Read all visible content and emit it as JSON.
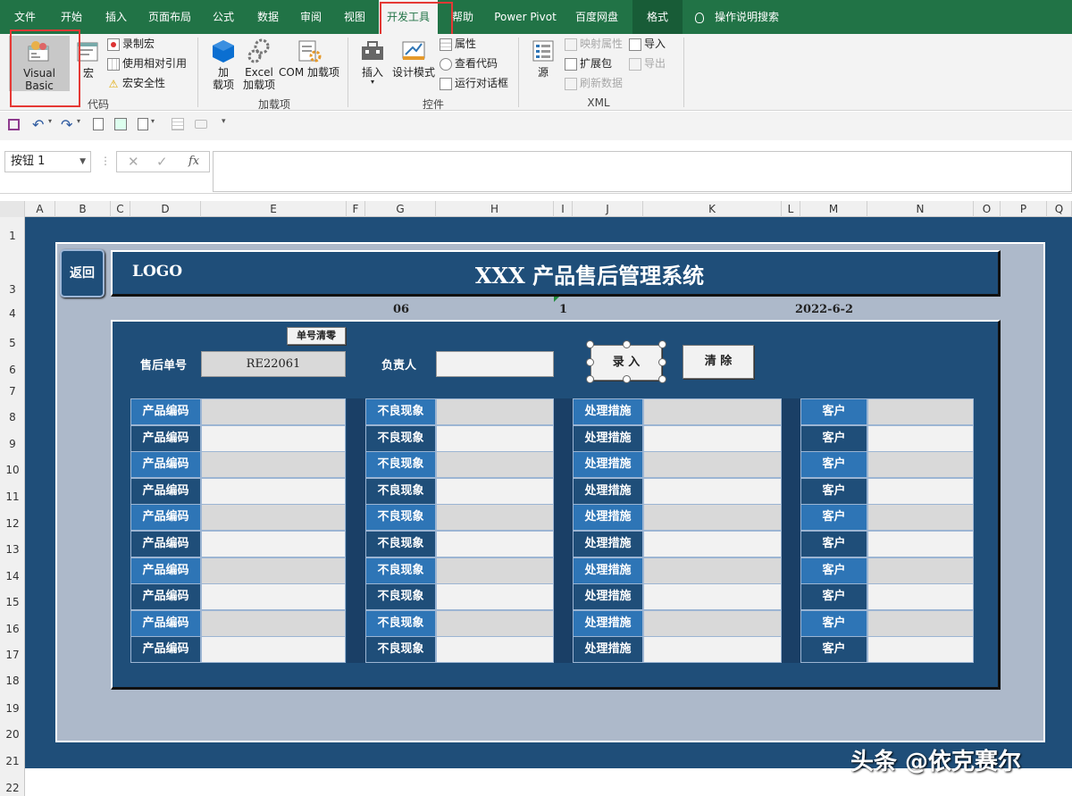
{
  "ribbon_tabs": [
    "文件",
    "开始",
    "插入",
    "页面布局",
    "公式",
    "数据",
    "审阅",
    "视图",
    "开发工具",
    "帮助",
    "Power Pivot",
    "百度网盘",
    "格式"
  ],
  "active_tab": "开发工具",
  "tell_me": "操作说明搜索",
  "groups": {
    "code": {
      "label": "代码",
      "visual_basic": "Visual Basic",
      "macros": "宏",
      "record_macro": "录制宏",
      "relative_ref": "使用相对引用",
      "macro_security": "宏安全性"
    },
    "addins": {
      "label": "加载项",
      "addins_l1": "加",
      "addins_l2": "载项",
      "excel_addins_l1": "Excel",
      "excel_addins_l2": "加载项",
      "com_addins": "COM 加载项"
    },
    "controls": {
      "label": "控件",
      "insert": "插入",
      "design_mode": "设计模式",
      "properties": "属性",
      "view_code": "查看代码",
      "run_dialog": "运行对话框"
    },
    "xml": {
      "label": "XML",
      "source": "源",
      "map_props": "映射属性",
      "expansion_packs": "扩展包",
      "refresh_data": "刷新数据",
      "import": "导入",
      "export": "导出"
    }
  },
  "namebox": "按钮 1",
  "fx_label": "fx",
  "columns": [
    "A",
    "B",
    "C",
    "D",
    "E",
    "F",
    "G",
    "H",
    "I",
    "J",
    "K",
    "L",
    "M",
    "N",
    "O",
    "P",
    "Q"
  ],
  "rows": [
    "1",
    "3",
    "4",
    "5",
    "6",
    "7",
    "8",
    "9",
    "10",
    "11",
    "12",
    "13",
    "14",
    "15",
    "16",
    "17",
    "18",
    "19",
    "20",
    "21",
    "22"
  ],
  "app": {
    "back": "返回",
    "logo": "LOGO",
    "title": "XXX 产品售后管理系统",
    "meta_left": "06",
    "meta_mid": "1",
    "meta_date": "2022-6-2",
    "clear_no": "单号清零",
    "order_label": "售后单号",
    "order_value": "RE22061",
    "owner_label": "负责人",
    "owner_value": "",
    "submit": "录 入",
    "clear": "清 除",
    "col_labels": [
      "产品编码",
      "不良现象",
      "处理措施",
      "客户"
    ]
  },
  "colors": {
    "ribbon": "#217346",
    "navy": "#1f4e79",
    "accent_blue": "#2e75b6",
    "panel": "#adb9ca"
  },
  "watermark": "头条 @依克赛尔"
}
